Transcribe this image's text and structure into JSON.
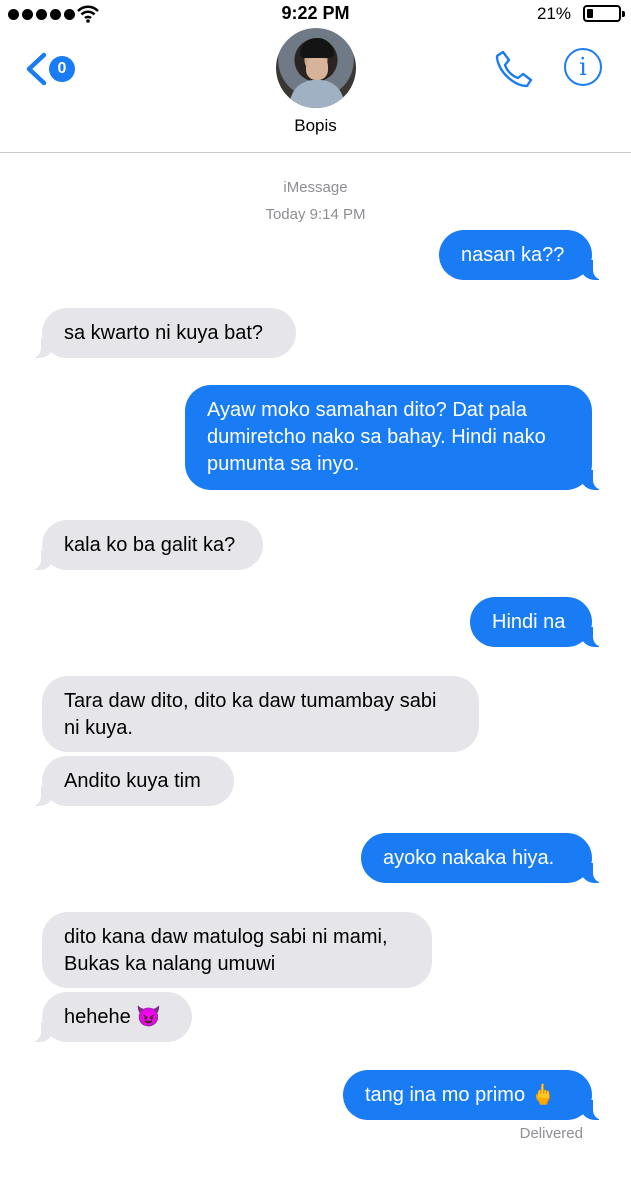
{
  "status_bar": {
    "time": "9:22 PM",
    "battery": "21%"
  },
  "header": {
    "back_badge": "0",
    "contact_name": "Bopis"
  },
  "thread": {
    "service": "iMessage",
    "timestamp": "Today 9:14 PM",
    "messages": [
      {
        "direction": "sent",
        "text": "nasan ka??"
      },
      {
        "direction": "received",
        "text": "sa kwarto ni kuya bat?"
      },
      {
        "direction": "sent",
        "text": "Ayaw moko samahan dito? Dat pala dumiretcho nako sa bahay. Hindi nako pumunta sa inyo."
      },
      {
        "direction": "received",
        "text": "kala ko ba galit ka?"
      },
      {
        "direction": "sent",
        "text": "Hindi na"
      },
      {
        "direction": "received",
        "text": "Tara daw dito, dito ka daw tumambay sabi ni kuya."
      },
      {
        "direction": "received",
        "text": "Andito kuya tim"
      },
      {
        "direction": "sent",
        "text": "ayoko nakaka hiya."
      },
      {
        "direction": "received",
        "text": "dito kana daw matulog sabi ni mami, Bukas ka nalang umuwi"
      },
      {
        "direction": "received",
        "text": "hehehe 😈"
      },
      {
        "direction": "sent",
        "text": "tang ina mo primo 🖕"
      }
    ],
    "delivery_status": "Delivered"
  },
  "colors": {
    "sent_bubble": "#1a7cf5",
    "received_bubble": "#e5e5ea",
    "accent": "#1a7cf5"
  }
}
